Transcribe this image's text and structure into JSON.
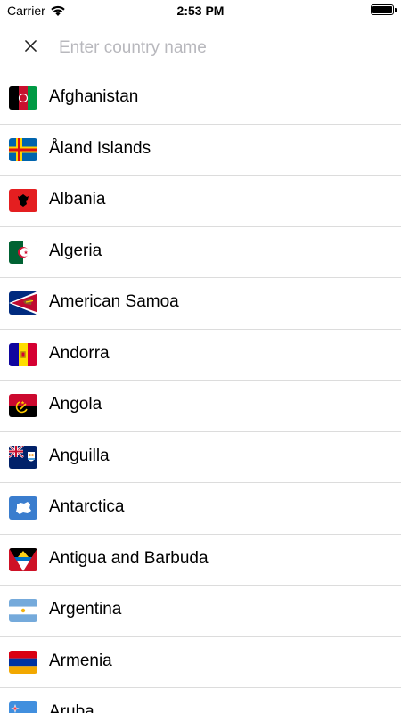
{
  "status_bar": {
    "carrier": "Carrier",
    "time": "2:53 PM",
    "wifi_icon": "wifi-icon",
    "battery_icon": "battery-icon"
  },
  "search": {
    "placeholder": "Enter country name",
    "value": "",
    "close_icon": "close-icon"
  },
  "countries": [
    {
      "name": "Afghanistan",
      "flag": "af"
    },
    {
      "name": "Åland Islands",
      "flag": "ax"
    },
    {
      "name": "Albania",
      "flag": "al"
    },
    {
      "name": "Algeria",
      "flag": "dz"
    },
    {
      "name": "American Samoa",
      "flag": "as"
    },
    {
      "name": "Andorra",
      "flag": "ad"
    },
    {
      "name": "Angola",
      "flag": "ao"
    },
    {
      "name": "Anguilla",
      "flag": "ai"
    },
    {
      "name": "Antarctica",
      "flag": "aq"
    },
    {
      "name": "Antigua and Barbuda",
      "flag": "ag"
    },
    {
      "name": "Argentina",
      "flag": "ar"
    },
    {
      "name": "Armenia",
      "flag": "am"
    },
    {
      "name": "Aruba",
      "flag": "aw"
    }
  ]
}
